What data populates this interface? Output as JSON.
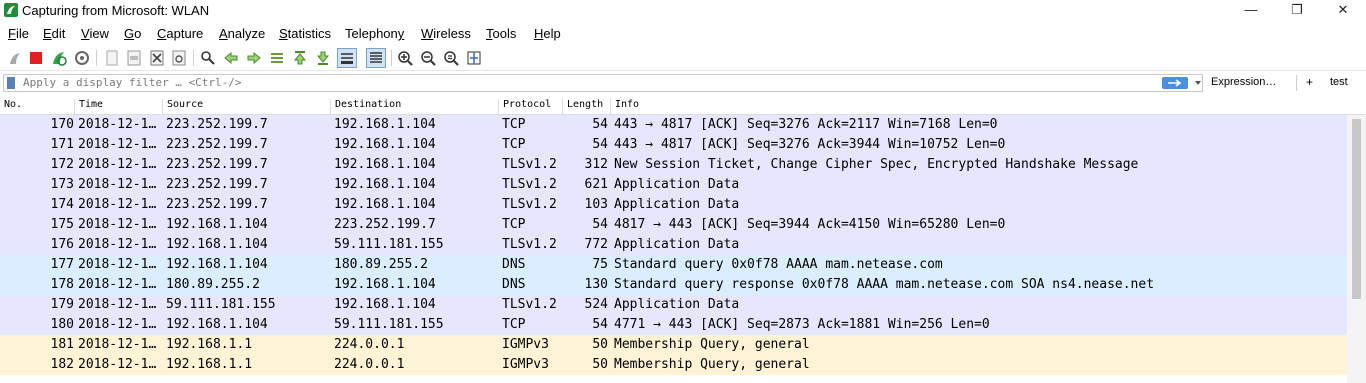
{
  "window": {
    "title": "Capturing from Microsoft: WLAN",
    "minimize": "—",
    "restore": "❐",
    "close": "✕"
  },
  "menu": [
    {
      "label": "File",
      "key": "F",
      "rest": "ile"
    },
    {
      "label": "Edit",
      "key": "E",
      "rest": "dit"
    },
    {
      "label": "View",
      "key": "V",
      "rest": "iew"
    },
    {
      "label": "Go",
      "key": "G",
      "rest": "o"
    },
    {
      "label": "Capture",
      "key": "C",
      "rest": "apture"
    },
    {
      "label": "Analyze",
      "key": "A",
      "rest": "nalyze"
    },
    {
      "label": "Statistics",
      "key": "S",
      "rest": "tatistics"
    },
    {
      "label": "Telephony",
      "pre": "Telephon",
      "key": "y",
      "rest": ""
    },
    {
      "label": "Wireless",
      "key": "W",
      "rest": "ireless"
    },
    {
      "label": "Tools",
      "key": "T",
      "rest": "ools"
    },
    {
      "label": "Help",
      "key": "H",
      "rest": "elp"
    }
  ],
  "filter": {
    "placeholder": "Apply a display filter … <Ctrl-/>",
    "expression_label": "Expression…",
    "plus_label": "+",
    "test_label": "test"
  },
  "columns": [
    "No.",
    "Time",
    "Source",
    "Destination",
    "Protocol",
    "Length",
    "Info"
  ],
  "colors": {
    "tcp": "#e7e6ff",
    "udp": "#daeeff",
    "igmp": "#fff3d6"
  },
  "packets": [
    {
      "no": "170",
      "time": "2018-12-1…",
      "src": "223.252.199.7",
      "dst": "192.168.1.104",
      "proto": "TCP",
      "len": "54",
      "info": "443 → 4817 [ACK] Seq=3276 Ack=2117 Win=7168 Len=0",
      "color": "tcp"
    },
    {
      "no": "171",
      "time": "2018-12-1…",
      "src": "223.252.199.7",
      "dst": "192.168.1.104",
      "proto": "TCP",
      "len": "54",
      "info": "443 → 4817 [ACK] Seq=3276 Ack=3944 Win=10752 Len=0",
      "color": "tcp"
    },
    {
      "no": "172",
      "time": "2018-12-1…",
      "src": "223.252.199.7",
      "dst": "192.168.1.104",
      "proto": "TLSv1.2",
      "len": "312",
      "info": "New Session Ticket, Change Cipher Spec, Encrypted Handshake Message",
      "color": "tcp"
    },
    {
      "no": "173",
      "time": "2018-12-1…",
      "src": "223.252.199.7",
      "dst": "192.168.1.104",
      "proto": "TLSv1.2",
      "len": "621",
      "info": "Application Data",
      "color": "tcp"
    },
    {
      "no": "174",
      "time": "2018-12-1…",
      "src": "223.252.199.7",
      "dst": "192.168.1.104",
      "proto": "TLSv1.2",
      "len": "103",
      "info": "Application Data",
      "color": "tcp"
    },
    {
      "no": "175",
      "time": "2018-12-1…",
      "src": "192.168.1.104",
      "dst": "223.252.199.7",
      "proto": "TCP",
      "len": "54",
      "info": "4817 → 443 [ACK] Seq=3944 Ack=4150 Win=65280 Len=0",
      "color": "tcp"
    },
    {
      "no": "176",
      "time": "2018-12-1…",
      "src": "192.168.1.104",
      "dst": "59.111.181.155",
      "proto": "TLSv1.2",
      "len": "772",
      "info": "Application Data",
      "color": "tcp"
    },
    {
      "no": "177",
      "time": "2018-12-1…",
      "src": "192.168.1.104",
      "dst": "180.89.255.2",
      "proto": "DNS",
      "len": "75",
      "info": "Standard query 0x0f78 AAAA mam.netease.com",
      "color": "udp"
    },
    {
      "no": "178",
      "time": "2018-12-1…",
      "src": "180.89.255.2",
      "dst": "192.168.1.104",
      "proto": "DNS",
      "len": "130",
      "info": "Standard query response 0x0f78 AAAA mam.netease.com SOA ns4.nease.net",
      "color": "udp"
    },
    {
      "no": "179",
      "time": "2018-12-1…",
      "src": "59.111.181.155",
      "dst": "192.168.1.104",
      "proto": "TLSv1.2",
      "len": "524",
      "info": "Application Data",
      "color": "tcp"
    },
    {
      "no": "180",
      "time": "2018-12-1…",
      "src": "192.168.1.104",
      "dst": "59.111.181.155",
      "proto": "TCP",
      "len": "54",
      "info": "4771 → 443 [ACK] Seq=2873 Ack=1881 Win=256 Len=0",
      "color": "tcp"
    },
    {
      "no": "181",
      "time": "2018-12-1…",
      "src": "192.168.1.1",
      "dst": "224.0.0.1",
      "proto": "IGMPv3",
      "len": "50",
      "info": "Membership Query, general",
      "color": "igmp"
    },
    {
      "no": "182",
      "time": "2018-12-1…",
      "src": "192.168.1.1",
      "dst": "224.0.0.1",
      "proto": "IGMPv3",
      "len": "50",
      "info": "Membership Query, general",
      "color": "igmp"
    }
  ]
}
